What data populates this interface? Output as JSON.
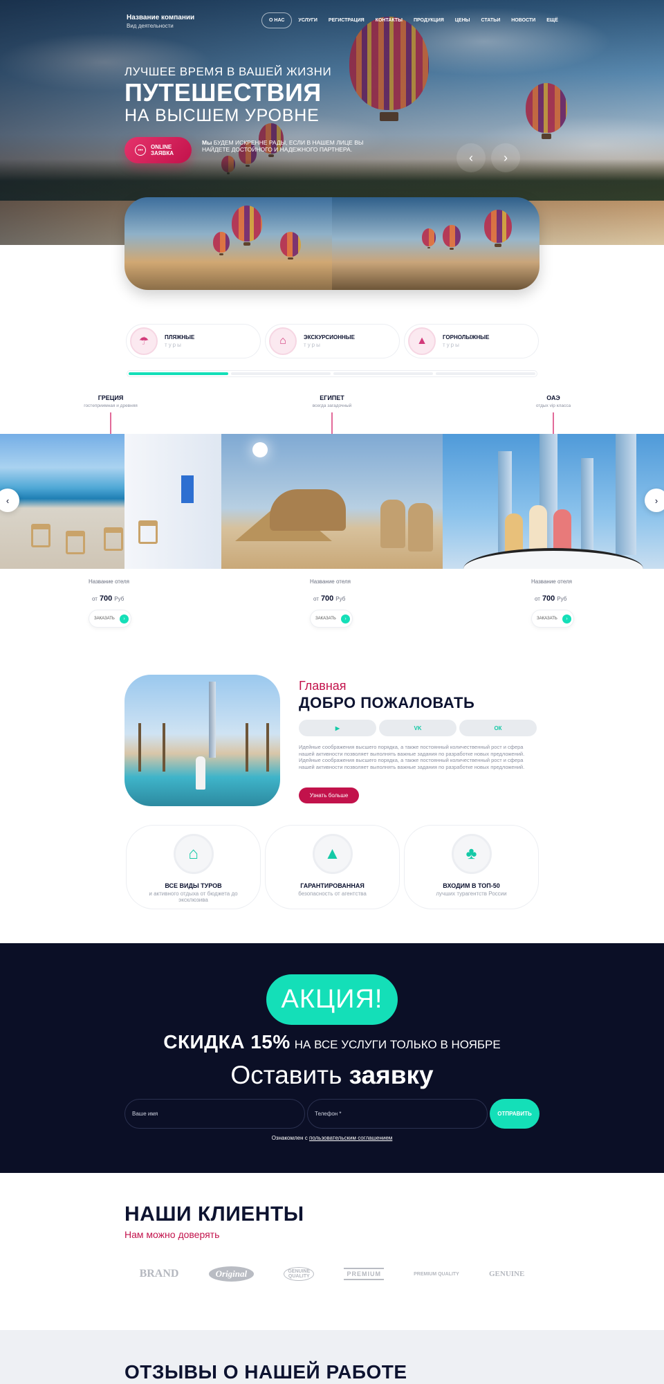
{
  "header": {
    "company_name": "Название компании",
    "activity": "Вид деятельности",
    "nav": [
      "О НАС",
      "УСЛУГИ",
      "РЕГИСТРАЦИЯ",
      "КОНТАКТЫ",
      "ПРОДУКЦИЯ",
      "ЦЕНЫ",
      "СТАТЬИ",
      "НОВОСТИ",
      "ЕЩЁ"
    ]
  },
  "hero": {
    "subtitle": "ЛУЧШЕЕ ВРЕМЯ В ВАШЕЙ ЖИЗНИ",
    "title": "ПУТЕШЕСТВИЯ",
    "subtitle2": "НА ВЫСШЕМ УРОВНЕ",
    "cta_line1": "ONLINE",
    "cta_line2": "ЗАЯВКА",
    "desc_bold": "Мы",
    "desc": "БУДЕМ ИСКРЕННЕ РАДЫ, ЕСЛИ В НАШЕМ ЛИЦЕ ВЫ НАЙДЕТЕ ДОСТОЙНОГО И НАДЕЖНОГО ПАРТНЕРА."
  },
  "tour_types": [
    {
      "title": "ПЛЯЖНЫЕ",
      "sub": "туры",
      "icon": "beach-icon"
    },
    {
      "title": "ЭКСКУРСИОННЫЕ",
      "sub": "туры",
      "icon": "excursion-icon"
    },
    {
      "title": "ГОРНОЛЫЖНЫЕ",
      "sub": "туры",
      "icon": "ski-icon"
    }
  ],
  "progress_active": 1,
  "destinations": [
    {
      "title": "ГРЕЦИЯ",
      "sub": "гостеприимная и древняя",
      "hotel": "Название отеля",
      "from": "от",
      "price": "700",
      "currency": "Руб",
      "order": "ЗАКАЗАТЬ"
    },
    {
      "title": "ЕГИПЕТ",
      "sub": "всегда загадочный",
      "hotel": "Название отеля",
      "from": "от",
      "price": "700",
      "currency": "Руб",
      "order": "ЗАКАЗАТЬ"
    },
    {
      "title": "ОАЭ",
      "sub": "отдых vip класса",
      "hotel": "Название отеля",
      "from": "от",
      "price": "700",
      "currency": "Руб",
      "order": "ЗАКАЗАТЬ"
    }
  ],
  "welcome": {
    "sub": "Главная",
    "title": "ДОБРО ПОЖАЛОВАТЬ",
    "socials": [
      "youtube-icon",
      "vk-icon",
      "ok-icon"
    ],
    "text": "Идейные соображения высшего порядка, а также постоянный количественный рост и сфера нашей активности позволяет выполнять важные задания по разработке новых предложений. Идейные соображения высшего порядка, а также постоянный количественный рост и сфера нашей активности позволяет выполнять важные задания по разработке новых предложений.",
    "button": "Узнать больше"
  },
  "features": [
    {
      "title": "ВСЕ ВИДЫ ТУРОВ",
      "sub": "и активного отдыха от бюджета до эксклюзива",
      "icon": "house-icon"
    },
    {
      "title": "ГАРАНТИРОВАННАЯ",
      "sub": "безопасность от агентства",
      "icon": "tent-icon"
    },
    {
      "title": "ВХОДИМ В ТОП-50",
      "sub": "лучших турагентств России",
      "icon": "tree-icon"
    }
  ],
  "promo": {
    "badge": "АКЦИЯ!",
    "discount": "СКИДКА 15%",
    "discount_note": "НА ВСЕ УСЛУГИ ТОЛЬКО В НОЯБРЕ",
    "title_light": "Оставить",
    "title_bold": "заявку",
    "name_placeholder": "Ваше имя",
    "phone_placeholder": "Телефон *",
    "send": "ОТПРАВИТЬ",
    "agree_text": "Ознакомлен с",
    "agree_link": "пользовательским соглашением"
  },
  "clients": {
    "title": "НАШИ КЛИЕНТЫ",
    "sub": "Нам можно доверять",
    "logos": [
      "BRAND",
      "Original",
      "GENUINE QUALITY",
      "PREMIUM",
      "PREMIUM QUALITY",
      "GENUINE"
    ]
  },
  "reviews": {
    "title": "ОТЗЫВЫ О НАШЕЙ РАБОТЕ"
  },
  "colors": {
    "accent": "#14dfb8",
    "brand": "#c2124b",
    "dark": "#0b0f26"
  }
}
